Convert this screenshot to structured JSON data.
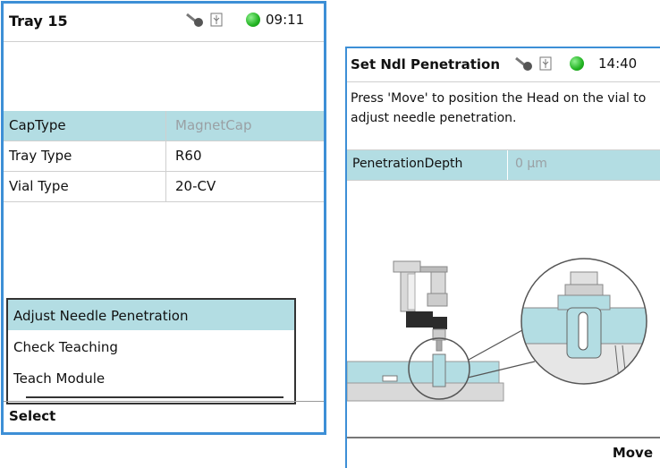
{
  "left": {
    "title": "Tray 15",
    "time": "09:11",
    "fields": [
      {
        "label": "CapType",
        "value": "MagnetCap"
      },
      {
        "label": "Tray Type",
        "value": "R60"
      },
      {
        "label": "Vial Type",
        "value": "20-CV"
      }
    ],
    "menu": [
      "Adjust Needle Penetration",
      "Check Teaching",
      "Teach Module"
    ],
    "softkey": "Select"
  },
  "right": {
    "title": "Set Ndl Penetration",
    "time": "14:40",
    "instruction": "Press 'Move' to position the Head on the vial to adjust needle penetration.",
    "field": {
      "label": "PenetrationDepth",
      "value": "0 µm"
    },
    "softkey": "Move"
  },
  "colors": {
    "frame": "#3d8fd6",
    "highlight": "#b3dde3",
    "status_ok": "#22b322"
  },
  "icons": [
    "key-icon",
    "usb-icon",
    "status-led-icon"
  ]
}
